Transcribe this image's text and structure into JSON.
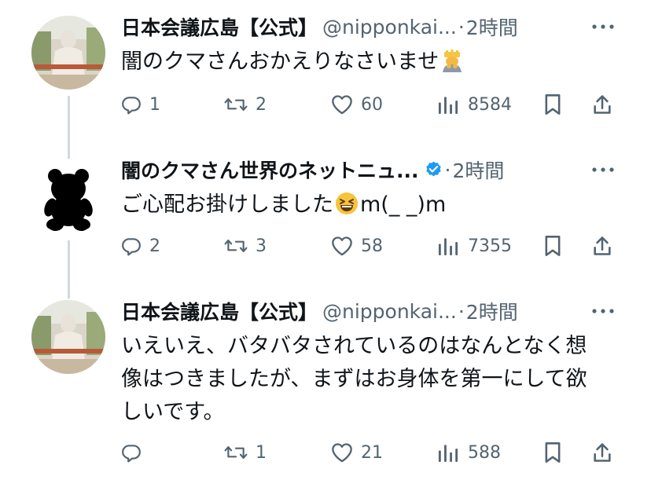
{
  "tweets": [
    {
      "name": "日本会議広島【公式】",
      "handle": "@nipponkai...",
      "separator": "·",
      "time": "2時間",
      "text": "闇のクマさんおかえりなさいませ",
      "text_emoji": "person-bowing-emoji",
      "verified": false,
      "avatar": "profile-photo",
      "replies": "1",
      "retweets": "2",
      "likes": "60",
      "views": "8584"
    },
    {
      "name": "闇のクマさん世界のネットニュ...",
      "handle": "",
      "separator": "·",
      "time": "2時間",
      "text_before": "ご心配お掛けしました",
      "text_emoji": "grinning-squinting-face-emoji",
      "text_after": "m(_ _)m",
      "verified": true,
      "avatar": "black-teddy-bear",
      "replies": "2",
      "retweets": "3",
      "likes": "58",
      "views": "7355"
    },
    {
      "name": "日本会議広島【公式】",
      "handle": "@nipponkai...",
      "separator": "·",
      "time": "2時間",
      "text": "いえいえ、バタバタされているのはなんとなく想像はつきましたが、まずはお身体を第一にして欲しいです。",
      "verified": false,
      "avatar": "profile-photo",
      "replies": "",
      "retweets": "1",
      "likes": "21",
      "views": "588"
    }
  ],
  "icons": {
    "reply": "reply-icon",
    "retweet": "retweet-icon",
    "like": "heart-icon",
    "views": "views-icon",
    "bookmark": "bookmark-icon",
    "share": "share-icon",
    "more": "more-icon",
    "verified": "verified-badge-icon"
  },
  "colors": {
    "text": "#0f1419",
    "secondary": "#536471",
    "verified": "#1d9bf0",
    "thread_line": "#cfd9de"
  }
}
